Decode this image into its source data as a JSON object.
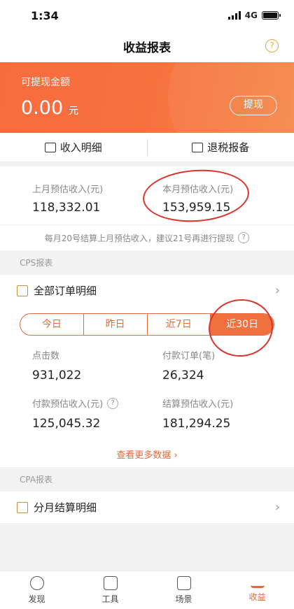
{
  "status": {
    "time": "1:34",
    "network": "4G"
  },
  "nav": {
    "title": "收益报表",
    "help": "?"
  },
  "balance": {
    "label": "可提现金额",
    "amount": "0.00",
    "unit": "元",
    "withdraw": "提现"
  },
  "actions": [
    {
      "label": "收入明细"
    },
    {
      "label": "退税报备"
    }
  ],
  "estimate": {
    "last_month_label": "上月预估收入(元)",
    "last_month_value": "118,332.01",
    "this_month_label": "本月预估收入(元)",
    "this_month_value": "153,959.15",
    "tip": "每月20号结算上月预估收入，建议21号再进行提现"
  },
  "cps": {
    "section": "CPS报表",
    "all_orders": "全部订单明细",
    "periods": [
      "今日",
      "昨日",
      "近7日",
      "近30日"
    ],
    "active_period": "近30日",
    "stats": [
      {
        "label": "点击数",
        "value": "931,022"
      },
      {
        "label": "付款订单(笔)",
        "value": "26,324"
      },
      {
        "label": "付款预估收入(元)",
        "value": "125,045.32"
      },
      {
        "label": "结算预估收入(元)",
        "value": "181,294.25"
      }
    ],
    "more": "查看更多数据"
  },
  "cpa": {
    "section": "CPA报表",
    "monthly": "分月结算明细"
  },
  "tabs": [
    {
      "label": "发现"
    },
    {
      "label": "工具"
    },
    {
      "label": "场景"
    },
    {
      "label": "收益"
    }
  ],
  "colors": {
    "accent": "#f0703f",
    "annotation": "#d8342c"
  }
}
